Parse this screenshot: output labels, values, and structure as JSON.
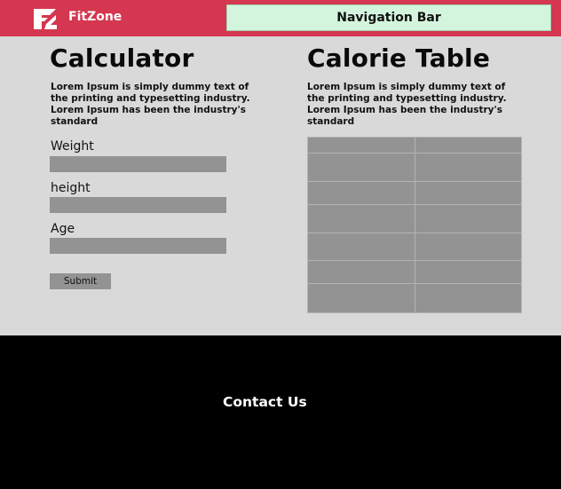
{
  "header": {
    "brand": "FitZone",
    "navigation_bar": "Navigation Bar",
    "colors": {
      "header_bg": "#d4374f",
      "nav_bg": "#d4f5dd"
    }
  },
  "calculator": {
    "title": "Calculator",
    "description": "Lorem Ipsum is simply dummy text of the printing and typesetting industry. Lorem Ipsum has been the industry's standard",
    "fields": [
      {
        "label": "Weight",
        "value": ""
      },
      {
        "label": "height",
        "value": ""
      },
      {
        "label": "Age",
        "value": ""
      }
    ],
    "submit_label": "Submit"
  },
  "calorie_table": {
    "title": "Calorie Table",
    "description": "Lorem Ipsum is simply dummy text of the printing and typesetting industry. Lorem Ipsum has been the industry's standard",
    "rows": [
      [
        "",
        ""
      ],
      [
        "",
        ""
      ],
      [
        "",
        ""
      ],
      [
        "",
        ""
      ],
      [
        "",
        ""
      ],
      [
        "",
        ""
      ],
      [
        "",
        ""
      ]
    ]
  },
  "footer": {
    "contact": "Contact Us"
  }
}
